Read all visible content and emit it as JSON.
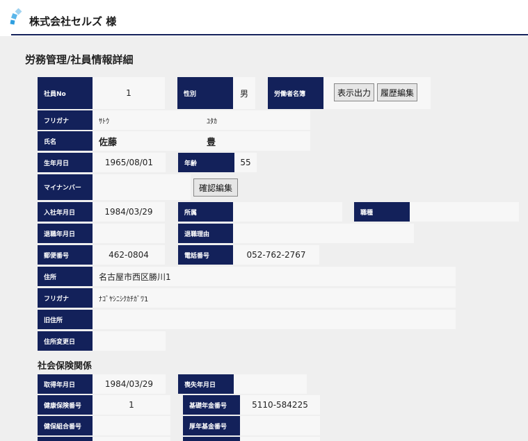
{
  "header": {
    "company": "株式会社セルズ 様"
  },
  "page_title": "労務管理/社員情報詳細",
  "employee": {
    "no_label": "社員No",
    "no": "1",
    "gender_label": "性別",
    "gender": "男",
    "roster_label": "労働者名簿",
    "btn_print": "表示出力",
    "btn_history": "履歴編集",
    "kana_label": "フリガナ",
    "kana_last": "ｻﾄｳ",
    "kana_first": "ﾕﾀｶ",
    "name_label": "氏名",
    "last_name": "佐藤",
    "first_name": "豊",
    "birth_label": "生年月日",
    "birth": "1965/08/01",
    "age_label": "年齢",
    "age": "55",
    "mynumber_label": "マイナンバー",
    "btn_confirm": "確認編集",
    "hire_label": "入社年月日",
    "hire": "1984/03/29",
    "dept_label": "所属",
    "dept": "",
    "job_label": "職種",
    "job": "",
    "retire_label": "退職年月日",
    "retire": "",
    "retire_reason_label": "退職理由",
    "retire_reason": "",
    "postal_label": "郵便番号",
    "postal": "462-0804",
    "phone_label": "電話番号",
    "phone": "052-762-2767",
    "address_label": "住所",
    "address": "名古屋市西区勝川1",
    "address_kana_label": "フリガナ",
    "address_kana": "ﾅｺﾞﾔｼﾆｼｸｶﾁｶﾞﾜ1",
    "old_address_label": "旧住所",
    "old_address": "",
    "address_change_label": "住所変更日",
    "address_change": ""
  },
  "social": {
    "title": "社会保険関係",
    "acquired_label": "取得年月日",
    "acquired": "1984/03/29",
    "lost_label": "喪失年月日",
    "lost": "",
    "health_no_label": "健康保険番号",
    "health_no": "1",
    "pension_no_label": "基礎年金番号",
    "pension_no": "5110-584225",
    "union_no_label": "健保組合番号",
    "union_no": "",
    "fund_no_label": "厚年基金番号",
    "fund_no": ""
  }
}
